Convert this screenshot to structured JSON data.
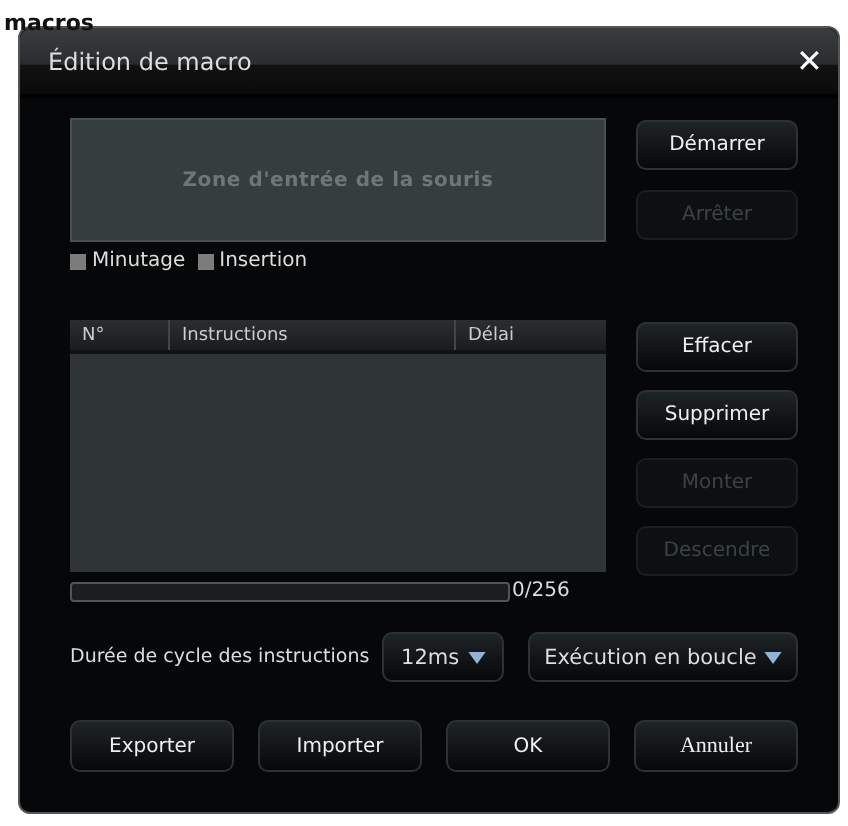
{
  "page_heading": "macros",
  "window": {
    "title": "Édition de macro",
    "close": "✕"
  },
  "mouse_zone": {
    "label": "Zone d'entrée de la souris"
  },
  "record_buttons": [
    {
      "label": "Démarrer",
      "disabled": false
    },
    {
      "label": "Arrêter",
      "disabled": true
    }
  ],
  "options": [
    {
      "label": "Minutage",
      "checked": false
    },
    {
      "label": "Insertion",
      "checked": false
    }
  ],
  "table": {
    "columns": [
      "N°",
      "Instructions",
      "Délai"
    ]
  },
  "edit_buttons": [
    {
      "label": "Effacer",
      "disabled": false
    },
    {
      "label": "Supprimer",
      "disabled": false
    },
    {
      "label": "Monter",
      "disabled": true
    },
    {
      "label": "Descendre",
      "disabled": true
    }
  ],
  "capacity": {
    "reading": "0/256"
  },
  "cycle": {
    "label": "Durée de cycle des instructions",
    "delay": "12ms",
    "mode": "Exécution en boucle"
  },
  "buttons": [
    {
      "label": "Exporter"
    },
    {
      "label": "Importer"
    },
    {
      "label": "OK"
    },
    {
      "label": "Annuler"
    }
  ]
}
